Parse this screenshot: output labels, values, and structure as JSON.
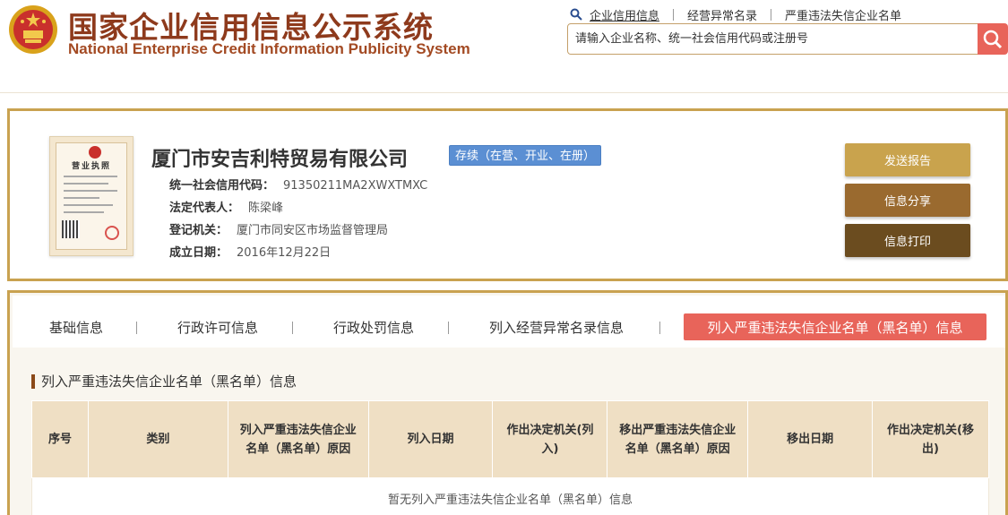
{
  "header": {
    "title_cn": "国家企业信用信息公示系统",
    "title_en": "National Enterprise Credit Information Publicity System",
    "links": [
      "企业信用信息",
      "经营异常名录",
      "严重违法失信企业名单"
    ],
    "search_placeholder": "请输入企业名称、统一社会信用代码或注册号"
  },
  "company": {
    "name": "厦门市安吉利特贸易有限公司",
    "status": "存续（在营、开业、在册）",
    "license_title": "营业执照",
    "fields": [
      {
        "key": "统一社会信用代码：",
        "value": "91350211MA2XWXTMXC"
      },
      {
        "key": "法定代表人：",
        "value": "陈梁峰"
      },
      {
        "key": "登记机关：",
        "value": "厦门市同安区市场监督管理局"
      },
      {
        "key": "成立日期：",
        "value": "2016年12月22日"
      }
    ]
  },
  "actions": [
    "发送报告",
    "信息分享",
    "信息打印"
  ],
  "tabs": [
    "基础信息",
    "行政许可信息",
    "行政处罚信息",
    "列入经营异常名录信息",
    "列入严重违法失信企业名单（黑名单）信息"
  ],
  "section": {
    "title": "列入严重违法失信企业名单（黑名单）信息",
    "columns": [
      "序号",
      "类别",
      "列入严重违法失信企业名单（黑名单）原因",
      "列入日期",
      "作出决定机关(列入)",
      "移出严重违法失信企业名单（黑名单）原因",
      "移出日期",
      "作出决定机关(移出)"
    ],
    "empty_text": "暂无列入严重违法失信企业名单（黑名单）信息"
  },
  "colors": {
    "accent": "#c9a250",
    "brand": "#8e3a1c",
    "active_tab": "#e8645a",
    "status": "#5b8fd3"
  }
}
